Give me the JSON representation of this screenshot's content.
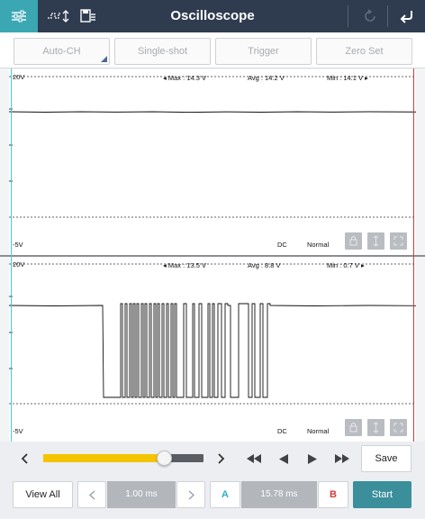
{
  "header": {
    "title": "Oscilloscope",
    "icons": [
      "settings-sliders-icon",
      "waveform-trigger-icon",
      "save-data-icon",
      "refresh-icon",
      "back-arrow-icon"
    ]
  },
  "modes": {
    "auto_ch": "Auto-CH",
    "single_shot": "Single-shot",
    "trigger": "Trigger",
    "zero_set": "Zero Set"
  },
  "channel1": {
    "top_label": "20V",
    "bottom_label": "-5V",
    "max": "Max : 14.3 V",
    "avg": "Avg : 14.2 V",
    "min": "Min : 14.1 V",
    "coupling": "DC",
    "mode": "Normal"
  },
  "channel2": {
    "top_label": "20V",
    "bottom_label": "-5V",
    "max": "Max : 13.5 V",
    "avg": "Avg : 8.8 V",
    "min": "Min : 0.7 V",
    "coupling": "DC",
    "mode": "Normal"
  },
  "controls": {
    "slider_value": 0.75,
    "save": "Save",
    "view_all": "View All",
    "timebase": "1.00 ms",
    "cursor_a": "A",
    "cursor_delta": "15.78 ms",
    "cursor_b": "B",
    "start": "Start"
  },
  "colors": {
    "header_bg": "#2f3b4f",
    "accent_teal": "#3aa7b3",
    "slider_fill": "#f5c400",
    "cursor_b_red": "#d43a3a",
    "cursor_a_cyan": "#4bc6d6"
  }
}
